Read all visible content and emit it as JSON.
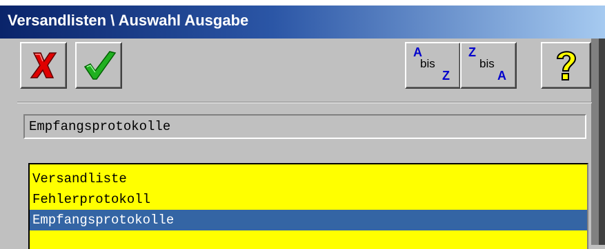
{
  "window": {
    "title": "Versandlisten \\ Auswahl Ausgabe"
  },
  "toolbar": {
    "cancel_icon": "red-x-icon",
    "ok_icon": "green-check-icon",
    "sort_asc": {
      "top": "A",
      "mid": "bis",
      "bottom": "Z"
    },
    "sort_desc": {
      "top": "Z",
      "mid": "bis",
      "bottom": "A"
    },
    "help_icon": "yellow-question-icon"
  },
  "selection": {
    "value": "Empfangsprotokolle"
  },
  "list": {
    "items": [
      "Versandliste",
      "Fehlerprotokoll",
      "Empfangsprotokolle"
    ],
    "selected_index": 2
  },
  "colors": {
    "title_start": "#0a246a",
    "title_end": "#a6caf0",
    "list_bg": "#ffff00",
    "selection": "#3465a4"
  }
}
